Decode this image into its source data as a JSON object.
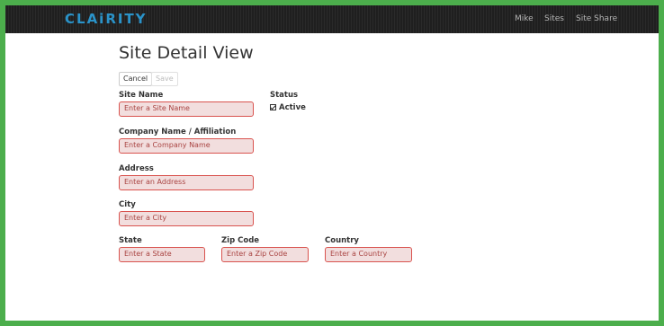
{
  "nav": {
    "brand": "CLAiRITY",
    "links": [
      "Mike",
      "Sites",
      "Site Share"
    ]
  },
  "page": {
    "title": "Site Detail View"
  },
  "toolbar": {
    "cancel_label": "Cancel",
    "save_label": "Save"
  },
  "form": {
    "site_name": {
      "label": "Site Name",
      "placeholder": "Enter a Site Name"
    },
    "status": {
      "label": "Status",
      "checkbox_label": "Active",
      "checked": true
    },
    "company": {
      "label": "Company Name / Affiliation",
      "placeholder": "Enter a Company Name"
    },
    "address": {
      "label": "Address",
      "placeholder": "Enter an Address"
    },
    "city": {
      "label": "City",
      "placeholder": "Enter a City"
    },
    "state": {
      "label": "State",
      "placeholder": "Enter a State"
    },
    "zip": {
      "label": "Zip Code",
      "placeholder": "Enter a Zip Code"
    },
    "country": {
      "label": "Country",
      "placeholder": "Enter a Country"
    }
  },
  "colors": {
    "frame": "#4cae4c",
    "navbar": "#1f1f1f",
    "brand": "#2a93c9",
    "error_border": "#d9534f",
    "error_bg": "#f2dede"
  }
}
